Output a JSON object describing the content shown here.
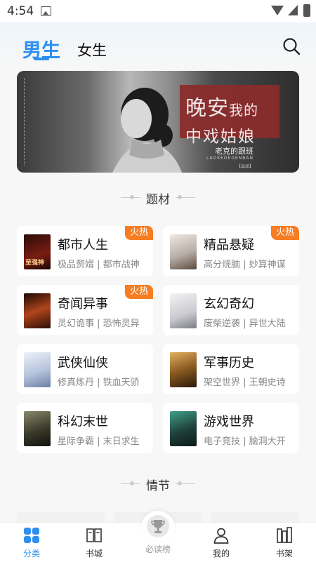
{
  "status_bar": {
    "time": "4:54"
  },
  "header": {
    "tabs": [
      {
        "label": "男生",
        "active": true
      },
      {
        "label": "女生",
        "active": false
      }
    ],
    "search_icon": "search-icon"
  },
  "banner": {
    "title_line1_big": "晚安",
    "title_line1_small": "我的",
    "title_line2": "中戏姑娘",
    "author": "老克的跟班",
    "pinyin": "LAOKEDEGENBAN",
    "tag": "【出品】"
  },
  "sections": {
    "topics": "题材",
    "plots": "情节"
  },
  "categories": [
    {
      "title": "都市人生",
      "tags": "极品赘婿 | 都市战神",
      "hot": "火热",
      "cover_text": "至强神",
      "cover_color": "#7a1d12"
    },
    {
      "title": "精品悬疑",
      "tags": "高分烧脑 | 妙算神谋",
      "hot": "火热",
      "cover_text": "",
      "cover_color": "#cfc7c0"
    },
    {
      "title": "奇闻异事",
      "tags": "灵幻诡事 | 恐怖灵异",
      "hot": "火热",
      "cover_text": "",
      "cover_color": "#5a2210"
    },
    {
      "title": "玄幻奇幻",
      "tags": "废柴逆袭 | 异世大陆",
      "hot": "",
      "cover_text": "",
      "cover_color": "#e8e8ea"
    },
    {
      "title": "武侠仙侠",
      "tags": "修真炼丹 | 铁血天骄",
      "hot": "",
      "cover_text": "",
      "cover_color": "#dbe3ef"
    },
    {
      "title": "军事历史",
      "tags": "架空世界 | 王朝史诗",
      "hot": "",
      "cover_text": "",
      "cover_color": "#8a5a22"
    },
    {
      "title": "科幻末世",
      "tags": "星际争霸 | 末日求生",
      "hot": "",
      "cover_text": "",
      "cover_color": "#3a3a2a"
    },
    {
      "title": "游戏世界",
      "tags": "电子竞技 | 脑洞大开",
      "hot": "",
      "cover_text": "",
      "cover_color": "#1f3f3a"
    }
  ],
  "tabbar": [
    {
      "label": "分类",
      "icon": "grid-icon",
      "active": true
    },
    {
      "label": "书城",
      "icon": "book-icon",
      "active": false
    },
    {
      "label": "必读榜",
      "icon": "trophy-icon",
      "active": false
    },
    {
      "label": "我的",
      "icon": "person-icon",
      "active": false
    },
    {
      "label": "书架",
      "icon": "bookshelf-icon",
      "active": false
    }
  ],
  "colors": {
    "accent": "#2d8ff0",
    "hot": "#f67d21"
  }
}
